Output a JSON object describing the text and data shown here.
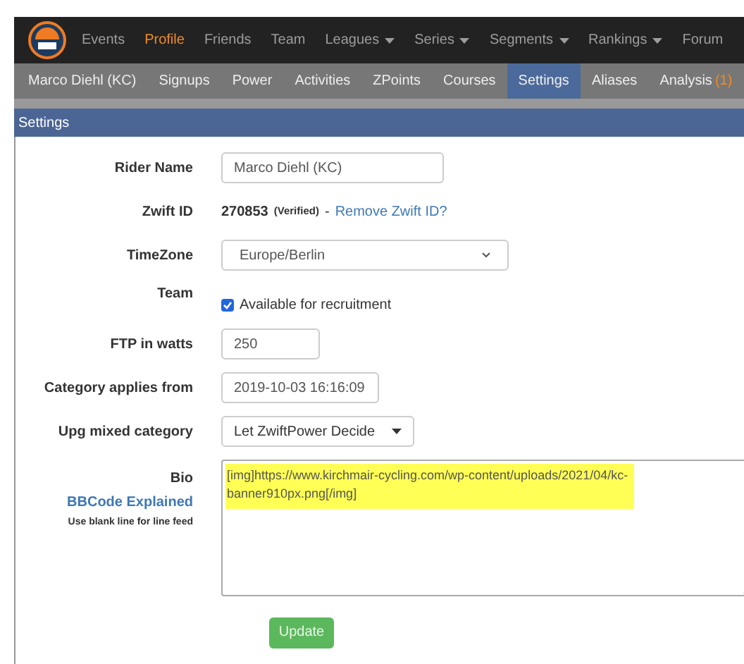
{
  "top_nav": [
    {
      "label": "Events",
      "selected": false,
      "caret": false
    },
    {
      "label": "Profile",
      "selected": true,
      "caret": false
    },
    {
      "label": "Friends",
      "selected": false,
      "caret": false
    },
    {
      "label": "Team",
      "selected": false,
      "caret": false
    },
    {
      "label": "Leagues",
      "selected": false,
      "caret": true
    },
    {
      "label": "Series",
      "selected": false,
      "caret": true
    },
    {
      "label": "Segments",
      "selected": false,
      "caret": true
    },
    {
      "label": "Rankings",
      "selected": false,
      "caret": true
    },
    {
      "label": "Forum",
      "selected": false
    }
  ],
  "sub_nav": [
    {
      "label": "Marco Diehl (KC)",
      "selected": false
    },
    {
      "label": "Signups",
      "selected": false
    },
    {
      "label": "Power",
      "selected": false
    },
    {
      "label": "Activities",
      "selected": false
    },
    {
      "label": "ZPoints",
      "selected": false
    },
    {
      "label": "Courses",
      "selected": false
    },
    {
      "label": "Settings",
      "selected": true
    },
    {
      "label": "Aliases",
      "selected": false
    },
    {
      "label": "Analysis",
      "selected": false,
      "count": "(1)"
    }
  ],
  "panel": {
    "title": "Settings"
  },
  "form": {
    "rows": [
      {
        "kind": "input",
        "label": "Rider Name",
        "value": "Marco Diehl (KC)"
      },
      {
        "kind": "id",
        "label": "Zwift ID",
        "id": "270853",
        "status": "(Verified)",
        "separator": "-",
        "link": "Remove Zwift ID?"
      },
      {
        "kind": "select",
        "label": "TimeZone",
        "value": "Europe/Berlin"
      },
      {
        "kind": "checkbox",
        "label": "Team",
        "option": "Available for recruitment",
        "checked": true
      },
      {
        "kind": "input",
        "label": "FTP in watts",
        "value": "250"
      },
      {
        "kind": "input",
        "label": "Category applies from",
        "value": "2019-10-03 16:16:09"
      },
      {
        "kind": "dropdown",
        "label": "Upg mixed category",
        "value": "Let ZwiftPower Decide"
      },
      {
        "kind": "bio",
        "label": "Bio",
        "link": "BBCode Explained",
        "hint": "Use blank line for line feed",
        "lines": [
          "[img]https://www.kirchmair-cycling.com/wp-content/uploads/2021/04/kc-",
          "banner910px.png[/img]"
        ],
        "highlighted": true
      }
    ],
    "submit": "Update"
  }
}
